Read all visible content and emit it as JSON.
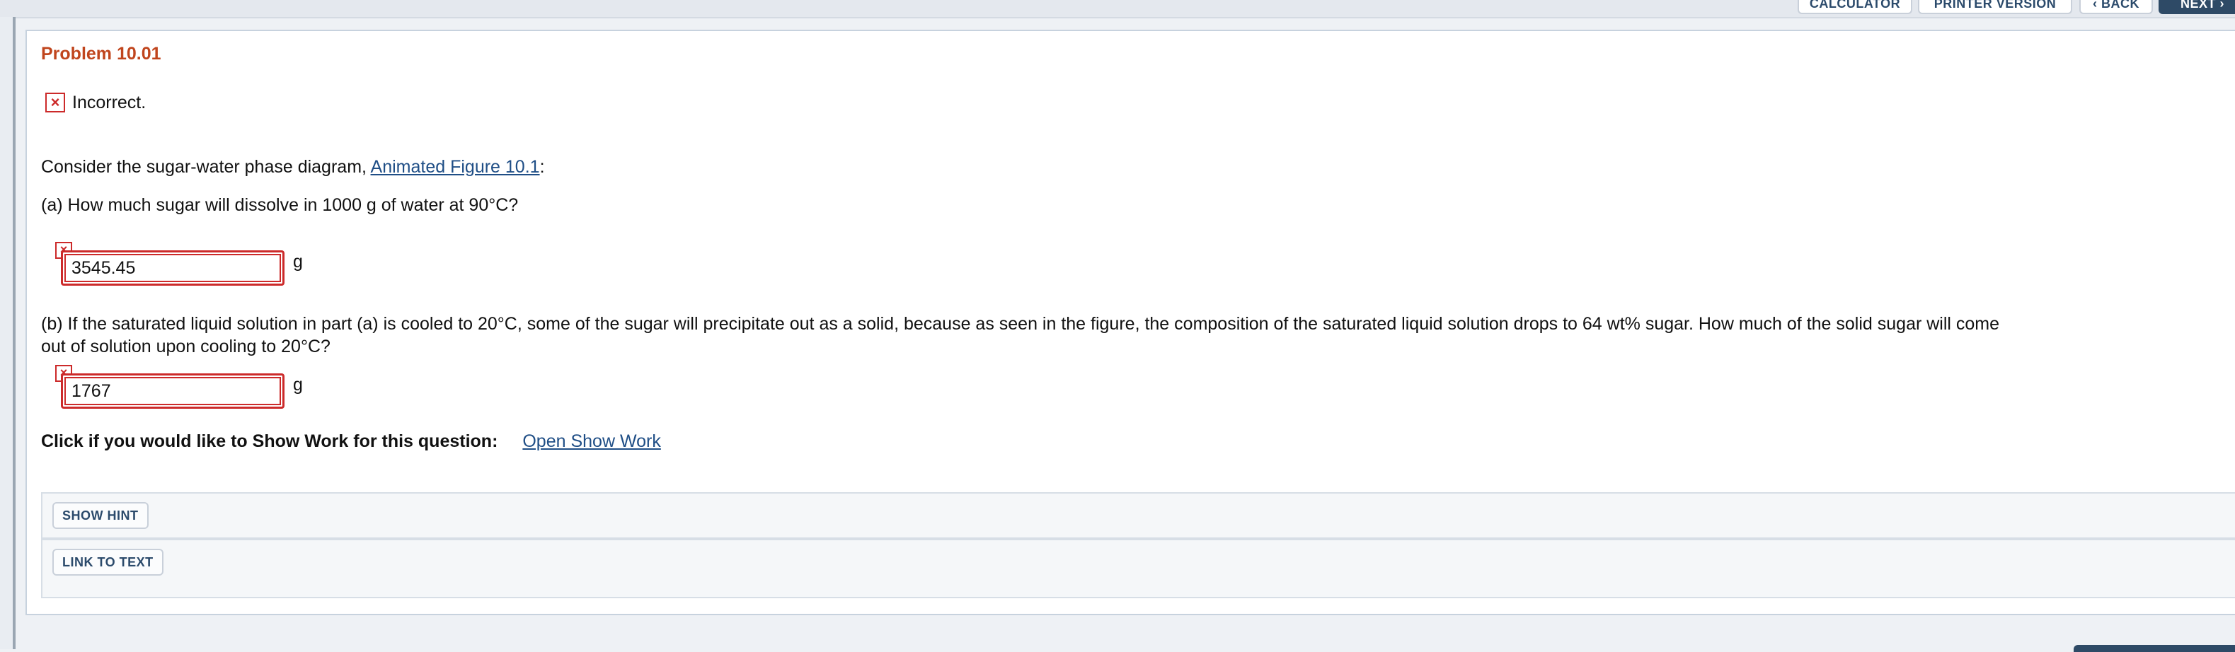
{
  "toolbar": {
    "calculator_label": "CALCULATOR",
    "printer_label": "PRINTER VERSION",
    "back_label": "‹ BACK",
    "next_label": "NEXT ›"
  },
  "problem": {
    "title": "Problem 10.01",
    "status": "Incorrect.",
    "intro_text": "Consider the sugar-water phase diagram, ",
    "intro_link": "Animated Figure 10.1",
    "intro_end": ":",
    "part_a": {
      "question": "(a) How much sugar will dissolve in 1000 g of water at 90°C?",
      "value": "3545.45",
      "unit": "g"
    },
    "part_b": {
      "question_line1": "(b) If the saturated liquid solution in part (a) is cooled to 20°C, some of the sugar will precipitate out as a solid, because as seen in the figure, the composition of the saturated liquid solution drops to 64 wt% sugar. How much of the solid sugar will come",
      "question_line2": "out of solution upon cooling to 20°C?",
      "value": "1767",
      "unit": "g"
    },
    "show_work_prompt": "Click if you would like to Show Work for this question:",
    "show_work_link": "Open Show Work"
  },
  "actions": {
    "show_hint": "SHOW HINT",
    "link_to_text": "LINK TO TEXT"
  },
  "colors": {
    "title": "#c0451d",
    "error": "#cc2a2a",
    "link": "#1f4e86"
  }
}
